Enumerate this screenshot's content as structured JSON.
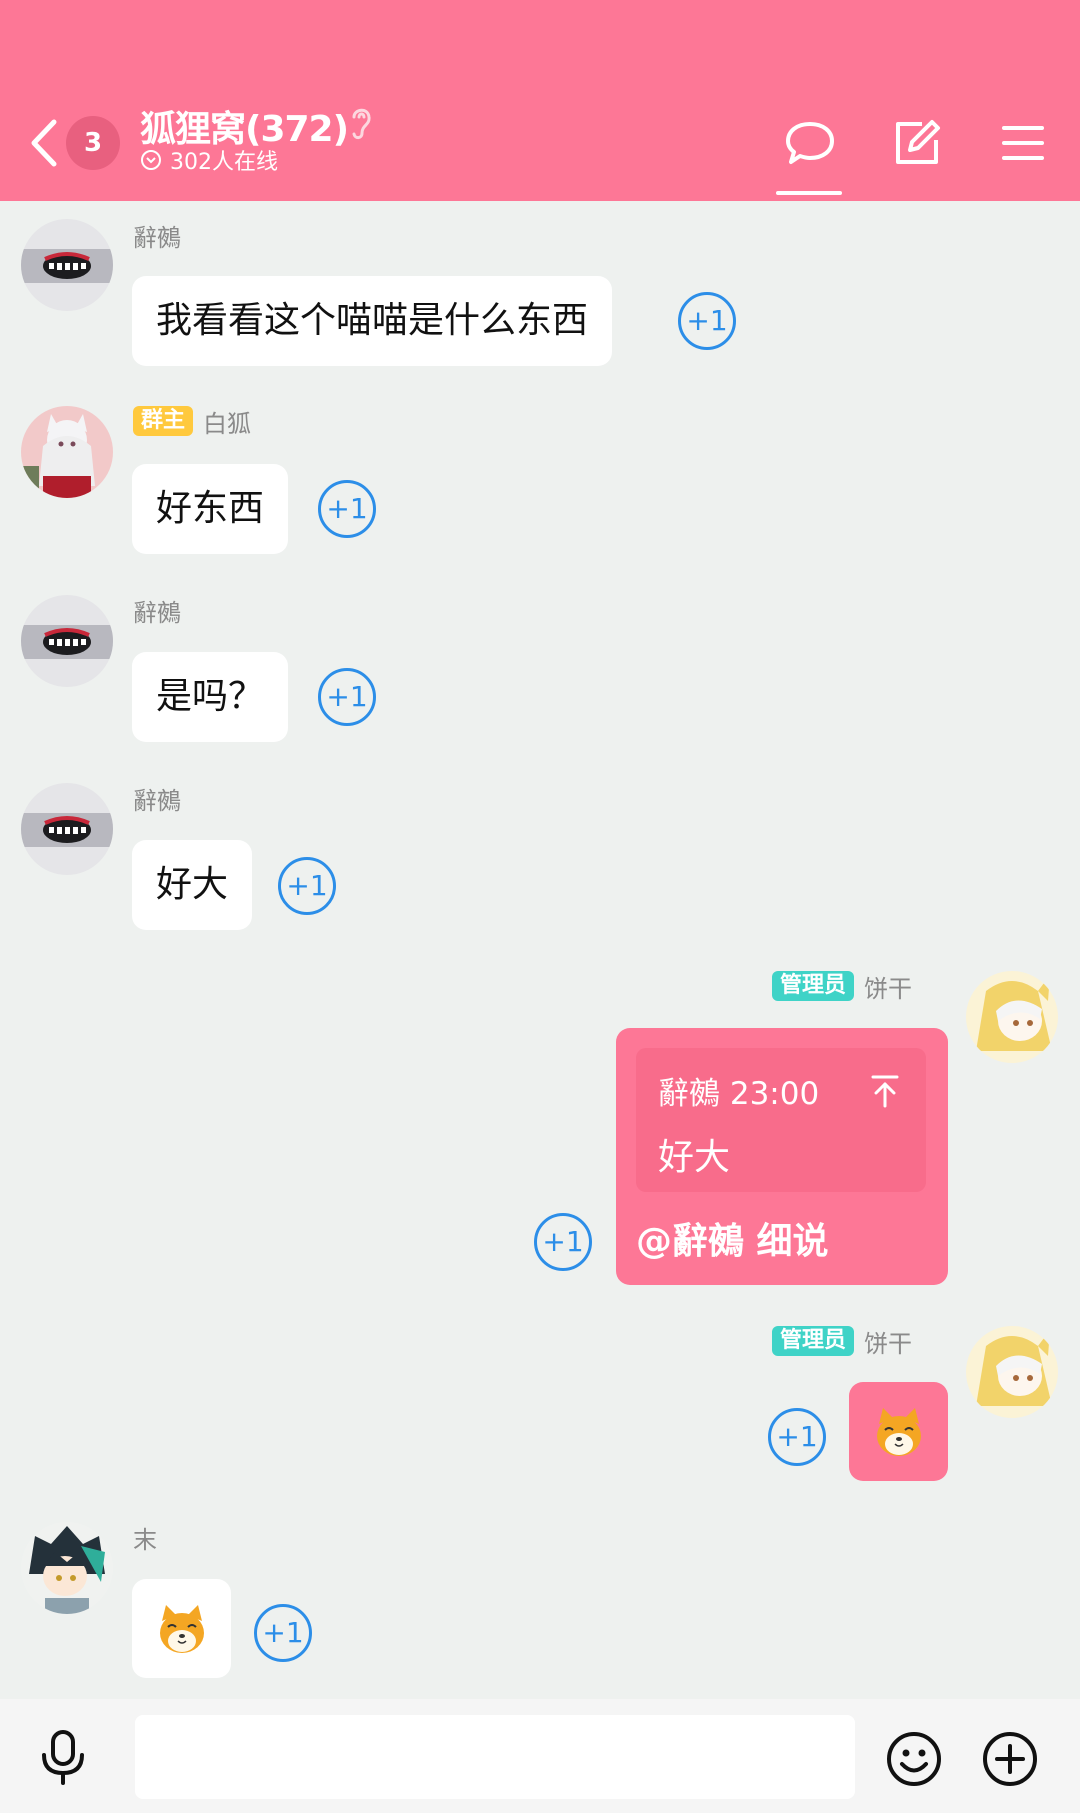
{
  "header": {
    "unread_count": "3",
    "title": "狐狸窝(372)",
    "online": "302人在线"
  },
  "messages": [
    {
      "sender": "辭鵺",
      "text": "我看看这个喵喵是什么东西",
      "plus": "+1"
    },
    {
      "role": "群主",
      "sender": "白狐",
      "text": "好东西",
      "plus": "+1"
    },
    {
      "sender": "辭鵺",
      "text": "是吗？",
      "plus": "+1"
    },
    {
      "sender": "辭鵺",
      "text": "好大",
      "plus": "+1"
    },
    {
      "role": "管理员",
      "sender": "饼干",
      "quote_meta": "辭鵺 23:00",
      "quote_text": "好大",
      "text": "@辭鵺 细说",
      "plus": "+1"
    },
    {
      "role": "管理员",
      "sender": "饼干",
      "sticker": "shiba-sticker",
      "plus": "+1"
    },
    {
      "sender": "末",
      "sticker": "shiba-sticker",
      "plus": "+1"
    }
  ],
  "input": {
    "value": ""
  },
  "colors": {
    "header": "#fd7796",
    "plus_one": "#2c8ee8",
    "owner_tag": "#ffc93d",
    "admin_tag": "#3fd3c7"
  },
  "icons": [
    "back-chevron-icon",
    "ear-icon",
    "online-status-icon",
    "chat-bubble-icon",
    "edit-icon",
    "menu-icon",
    "pin-up-icon",
    "mic-icon",
    "emoji-icon",
    "plus-circle-icon"
  ]
}
